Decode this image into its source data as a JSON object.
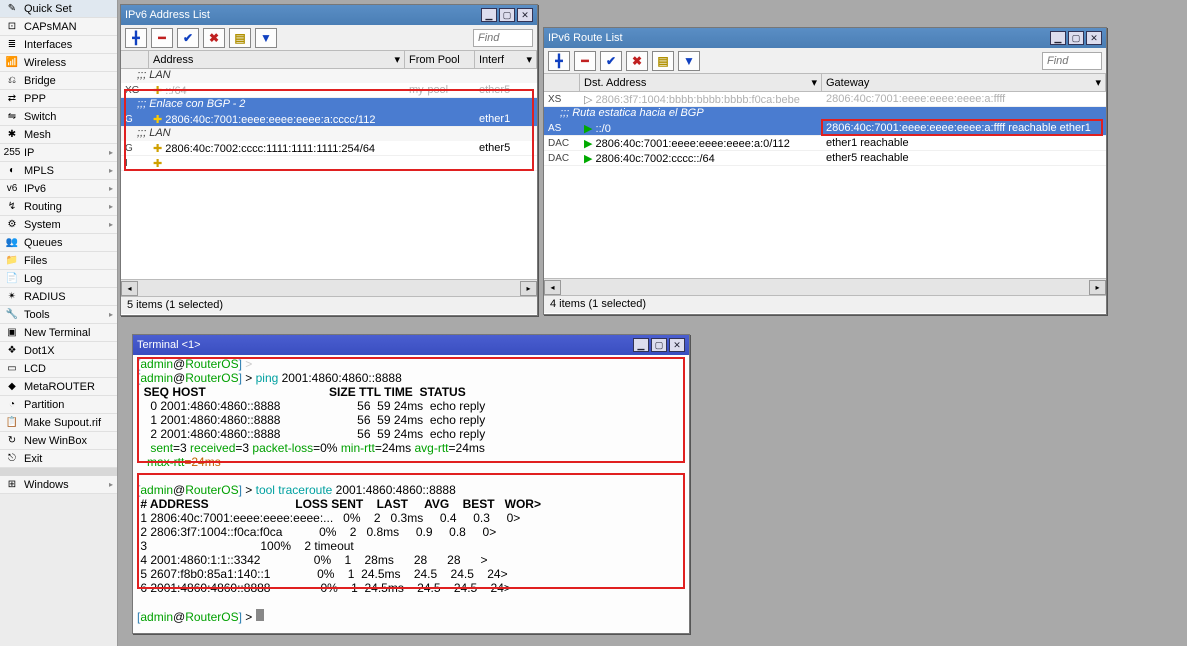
{
  "sidebar": {
    "items": [
      {
        "label": "Quick Set",
        "icon": "✎",
        "arrow": false
      },
      {
        "label": "CAPsMAN",
        "icon": "⊡",
        "arrow": false
      },
      {
        "label": "Interfaces",
        "icon": "≣",
        "arrow": false
      },
      {
        "label": "Wireless",
        "icon": "📶",
        "arrow": false
      },
      {
        "label": "Bridge",
        "icon": "⎌",
        "arrow": false
      },
      {
        "label": "PPP",
        "icon": "⇄",
        "arrow": false
      },
      {
        "label": "Switch",
        "icon": "⇋",
        "arrow": false
      },
      {
        "label": "Mesh",
        "icon": "✱",
        "arrow": false
      },
      {
        "label": "IP",
        "icon": "255",
        "arrow": true
      },
      {
        "label": "MPLS",
        "icon": "◐",
        "arrow": true
      },
      {
        "label": "IPv6",
        "icon": "v6",
        "arrow": true
      },
      {
        "label": "Routing",
        "icon": "↯",
        "arrow": true
      },
      {
        "label": "System",
        "icon": "⚙",
        "arrow": true
      },
      {
        "label": "Queues",
        "icon": "👥",
        "arrow": false
      },
      {
        "label": "Files",
        "icon": "📁",
        "arrow": false
      },
      {
        "label": "Log",
        "icon": "📄",
        "arrow": false
      },
      {
        "label": "RADIUS",
        "icon": "✴",
        "arrow": false
      },
      {
        "label": "Tools",
        "icon": "🔧",
        "arrow": true
      },
      {
        "label": "New Terminal",
        "icon": "▣",
        "arrow": false
      },
      {
        "label": "Dot1X",
        "icon": "❖",
        "arrow": false
      },
      {
        "label": "LCD",
        "icon": "▭",
        "arrow": false
      },
      {
        "label": "MetaROUTER",
        "icon": "◆",
        "arrow": false
      },
      {
        "label": "Partition",
        "icon": "◔",
        "arrow": false
      },
      {
        "label": "Make Supout.rif",
        "icon": "📋",
        "arrow": false
      },
      {
        "label": "New WinBox",
        "icon": "↻",
        "arrow": false
      },
      {
        "label": "Exit",
        "icon": "⎋",
        "arrow": false
      }
    ],
    "windowsLabel": "Windows"
  },
  "addressList": {
    "title": "IPv6 Address List",
    "findPlaceholder": "Find",
    "columns": {
      "addr": "Address",
      "pool": "From Pool",
      "iface": "Interf"
    },
    "rows": [
      {
        "type": "comment",
        "text": ";;; LAN"
      },
      {
        "type": "data",
        "flag": "XG",
        "addr": "::/64",
        "pool": "my-pool",
        "iface": "ether5",
        "dim": true
      },
      {
        "type": "comment",
        "text": ";;; Enlace con BGP - 2",
        "selected": true
      },
      {
        "type": "data",
        "flag": "G",
        "addr": "2806:40c:7001:eeee:eeee:eeee:a:cccc/112",
        "pool": "",
        "iface": "ether1",
        "selected": true
      },
      {
        "type": "comment",
        "text": ";;; LAN"
      },
      {
        "type": "data",
        "flag": "G",
        "addr": "2806:40c:7002:cccc:1111:1111:1111:254/64",
        "pool": "",
        "iface": "ether5"
      },
      {
        "type": "data",
        "flag": "I",
        "addr": "",
        "pool": "",
        "iface": "",
        "dim": true
      }
    ],
    "status": "5 items (1 selected)"
  },
  "routeList": {
    "title": "IPv6 Route List",
    "findPlaceholder": "Find",
    "columns": {
      "dst": "Dst. Address",
      "gw": "Gateway"
    },
    "rows": [
      {
        "type": "data",
        "flag": "XS",
        "dst": "2806:3f7:1004:bbbb:bbbb:bbbb:f0ca:bebe",
        "gw": "2806:40c:7001:eeee:eeee:eeee:a:ffff",
        "dim": true
      },
      {
        "type": "comment",
        "text": ";;; Ruta estatica hacia el BGP",
        "selected": true
      },
      {
        "type": "data",
        "flag": "AS",
        "dst": "::/0",
        "gw": "2806:40c:7001:eeee:eeee:eeee:a:ffff reachable ether1",
        "selected": true
      },
      {
        "type": "data",
        "flag": "DAC",
        "dst": "2806:40c:7001:eeee:eeee:eeee:a:0/112",
        "gw": "ether1 reachable"
      },
      {
        "type": "data",
        "flag": "DAC",
        "dst": "2806:40c:7002:cccc::/64",
        "gw": "ether5 reachable"
      }
    ],
    "status": "4 items (1 selected)"
  },
  "terminal": {
    "title": "Terminal <1>",
    "promptUser": "admin",
    "promptHost": "RouterOS",
    "pingCmd": "ping 2001:4860:4860::8888",
    "pingHead": "  SEQ HOST                                     SIZE TTL TIME  STATUS",
    "pingRows": [
      "    0 2001:4860:4860::8888                       56  59 24ms  echo reply",
      "    1 2001:4860:4860::8888                       56  59 24ms  echo reply",
      "    2 2001:4860:4860::8888                       56  59 24ms  echo reply"
    ],
    "pingSummaryParts": {
      "sent": "sent",
      "sentv": "=3 ",
      "recv": "received",
      "recvv": "=3 ",
      "pl": "packet-loss",
      "plv": "=0% ",
      "minr": "min-rtt",
      "minrv": "=24ms ",
      "avgr": "avg-rtt",
      "avgrv": "=24ms",
      "maxr": "max-rtt",
      "maxrv": "=24ms"
    },
    "traceCmd": "tool traceroute 2001:4860:4860::8888",
    "traceHead": " # ADDRESS                          LOSS SENT    LAST     AVG    BEST   WOR>",
    "traceRows": [
      " 1 2806:40c:7001:eeee:eeee:eeee:...   0%    2   0.3ms     0.4     0.3     0>",
      " 2 2806:3f7:1004::f0ca:f0ca           0%    2   0.8ms     0.9     0.8     0>",
      " 3                                  100%    2 timeout",
      " 4 2001:4860:1:1::3342                0%    1    28ms      28      28      >",
      " 5 2607:f8b0:85a1:140::1              0%    1  24.5ms    24.5    24.5    24>",
      " 6 2001:4860:4860::8888               0%    1  24.5ms    24.5    24.5    24>"
    ]
  }
}
